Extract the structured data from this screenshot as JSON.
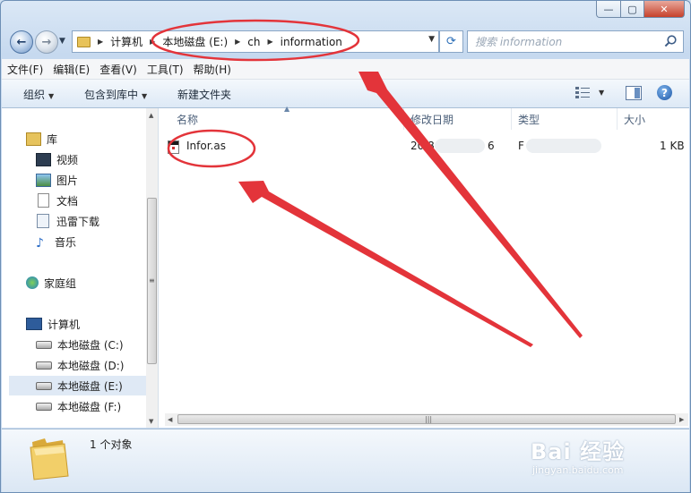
{
  "address_bar": {
    "path": [
      "计算机",
      "本地磁盘 (E:)",
      "ch",
      "information"
    ]
  },
  "search": {
    "placeholder": "搜索 information"
  },
  "menu": [
    "文件(F)",
    "编辑(E)",
    "查看(V)",
    "工具(T)",
    "帮助(H)"
  ],
  "toolbar": {
    "organize": "组织",
    "include_in_library": "包含到库中",
    "new_folder": "新建文件夹"
  },
  "navigation": {
    "libraries_label": "库",
    "libraries": [
      "视频",
      "图片",
      "文档",
      "迅雷下载",
      "音乐"
    ],
    "homegroup": "家庭组",
    "computer_label": "计算机",
    "drives": [
      "本地磁盘 (C:)",
      "本地磁盘 (D:)",
      "本地磁盘 (E:)",
      "本地磁盘 (F:)"
    ],
    "selected_drive": "本地磁盘 (E:)"
  },
  "columns": {
    "name": "名称",
    "date_modified": "修改日期",
    "type": "类型",
    "size": "大小"
  },
  "files": [
    {
      "name": "Infor.as",
      "date_modified_visible": "20  8",
      "date_modified_tail": "6",
      "type_visible": "F",
      "size": "1 KB"
    }
  ],
  "status": {
    "item_count": "1 个对象"
  },
  "watermark": {
    "brand": "Bai 经验",
    "url": "jingyan.baidu.com"
  },
  "colors": {
    "annotation_red": "#e3343a",
    "window_frame": "#c6d9ef",
    "selected_item": "#dfe9f5"
  }
}
